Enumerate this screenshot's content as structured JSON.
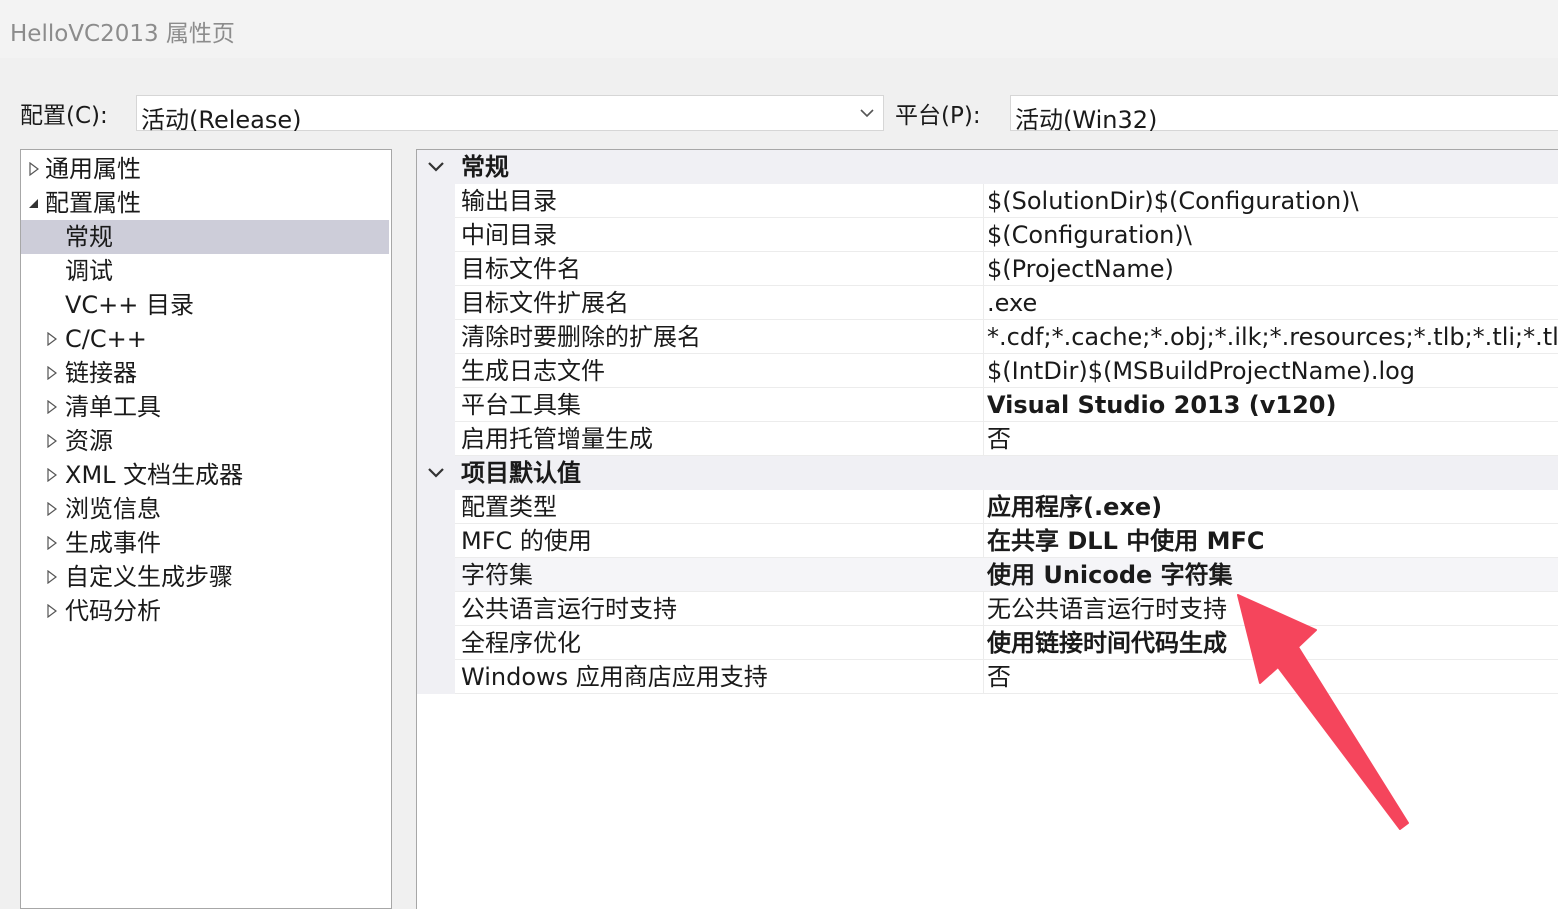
{
  "window": {
    "title": "HelloVC2013 属性页"
  },
  "toolbar": {
    "config_label": "配置(C):",
    "config_value": "活动(Release)",
    "platform_label": "平台(P):",
    "platform_value": "活动(Win32)"
  },
  "tree": {
    "items": [
      {
        "label": "通用属性",
        "expand": "collapsed"
      },
      {
        "label": "配置属性",
        "expand": "expanded"
      },
      {
        "label": "常规",
        "expand": "none",
        "selected": true
      },
      {
        "label": "调试",
        "expand": "none"
      },
      {
        "label": "VC++ 目录",
        "expand": "none"
      },
      {
        "label": "C/C++",
        "expand": "collapsed"
      },
      {
        "label": "链接器",
        "expand": "collapsed"
      },
      {
        "label": "清单工具",
        "expand": "collapsed"
      },
      {
        "label": "资源",
        "expand": "collapsed"
      },
      {
        "label": "XML 文档生成器",
        "expand": "collapsed"
      },
      {
        "label": "浏览信息",
        "expand": "collapsed"
      },
      {
        "label": "生成事件",
        "expand": "collapsed"
      },
      {
        "label": "自定义生成步骤",
        "expand": "collapsed"
      },
      {
        "label": "代码分析",
        "expand": "collapsed"
      }
    ]
  },
  "grid": {
    "categories": [
      {
        "label": "常规",
        "rows": [
          {
            "name": "输出目录",
            "value": "$(SolutionDir)$(Configuration)\\",
            "bold": false
          },
          {
            "name": "中间目录",
            "value": "$(Configuration)\\",
            "bold": false
          },
          {
            "name": "目标文件名",
            "value": "$(ProjectName)",
            "bold": false
          },
          {
            "name": "目标文件扩展名",
            "value": ".exe",
            "bold": false
          },
          {
            "name": "清除时要删除的扩展名",
            "value": "*.cdf;*.cache;*.obj;*.ilk;*.resources;*.tlb;*.tli;*.tlh;*.tr",
            "bold": false
          },
          {
            "name": "生成日志文件",
            "value": "$(IntDir)$(MSBuildProjectName).log",
            "bold": false
          },
          {
            "name": "平台工具集",
            "value": "Visual Studio 2013 (v120)",
            "bold": true
          },
          {
            "name": "启用托管增量生成",
            "value": "否",
            "bold": false
          }
        ]
      },
      {
        "label": "项目默认值",
        "rows": [
          {
            "name": "配置类型",
            "value": "应用程序(.exe)",
            "bold": true
          },
          {
            "name": "MFC 的使用",
            "value": "在共享 DLL 中使用 MFC",
            "bold": true
          },
          {
            "name": "字符集",
            "value": "使用 Unicode 字符集",
            "bold": true,
            "highlight": true
          },
          {
            "name": "公共语言运行时支持",
            "value": "无公共语言运行时支持",
            "bold": false
          },
          {
            "name": "全程序优化",
            "value": "使用链接时间代码生成",
            "bold": true
          },
          {
            "name": "Windows 应用商店应用支持",
            "value": "否",
            "bold": false
          }
        ]
      }
    ]
  },
  "annotation": {
    "arrow_color": "#f5455c",
    "target": "字符集"
  }
}
